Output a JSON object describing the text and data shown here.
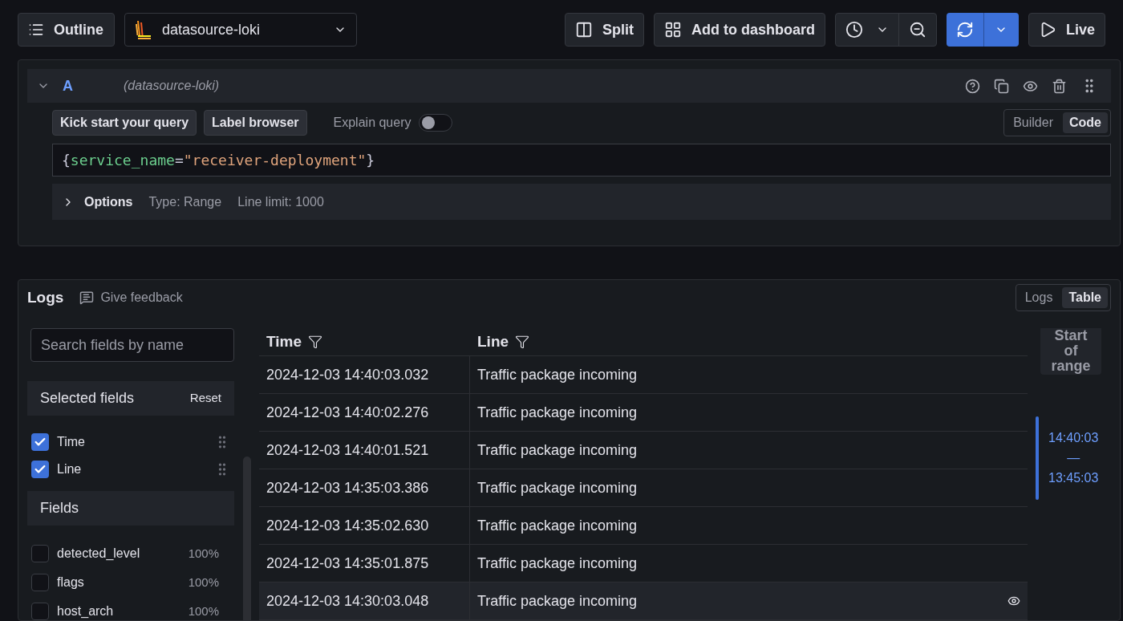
{
  "toolbar": {
    "outline": "Outline",
    "datasource": "datasource-loki",
    "split": "Split",
    "add_to_dashboard": "Add to dashboard",
    "live": "Live"
  },
  "query": {
    "ref": "A",
    "datasource": "(datasource-loki)",
    "expanded": true,
    "buttons": [
      "Kick start your query",
      "Label browser"
    ],
    "explain": {
      "label": "Explain query",
      "on": false
    },
    "mode_tabs": [
      {
        "label": "Builder",
        "selected": false
      },
      {
        "label": "Code",
        "selected": true
      }
    ],
    "expression": [
      {
        "kind": "punct",
        "text": "{"
      },
      {
        "kind": "label",
        "text": "service_name"
      },
      {
        "kind": "punct",
        "text": "="
      },
      {
        "kind": "string",
        "text": "\"receiver-deployment\""
      },
      {
        "kind": "punct",
        "text": "}"
      }
    ],
    "options": {
      "label": "Options",
      "expanded": false,
      "type": "Type: Range",
      "line_limit": "Line limit: 1000"
    }
  },
  "logs": {
    "title": "Logs",
    "feedback": "Give feedback",
    "view_tabs": [
      {
        "label": "Logs",
        "selected": false
      },
      {
        "label": "Table",
        "selected": true
      }
    ],
    "search": {
      "placeholder": "Search fields by name"
    },
    "selected_fields": {
      "title": "Selected fields",
      "reset": "Reset",
      "items": [
        {
          "name": "Time",
          "checked": true
        },
        {
          "name": "Line",
          "checked": true
        }
      ]
    },
    "fields": {
      "title": "Fields",
      "items": [
        {
          "name": "detected_level",
          "checked": false,
          "percent": "100%"
        },
        {
          "name": "flags",
          "checked": false,
          "percent": "100%"
        },
        {
          "name": "host_arch",
          "checked": false,
          "percent": "100%"
        }
      ]
    },
    "columns": [
      "Time",
      "Line"
    ],
    "rows": [
      {
        "time": "2024-12-03 14:40:03.032",
        "line": "Traffic package incoming",
        "hovered": false
      },
      {
        "time": "2024-12-03 14:40:02.276",
        "line": "Traffic package incoming",
        "hovered": false
      },
      {
        "time": "2024-12-03 14:40:01.521",
        "line": "Traffic package incoming",
        "hovered": false
      },
      {
        "time": "2024-12-03 14:35:03.386",
        "line": "Traffic package incoming",
        "hovered": false
      },
      {
        "time": "2024-12-03 14:35:02.630",
        "line": "Traffic package incoming",
        "hovered": false
      },
      {
        "time": "2024-12-03 14:35:01.875",
        "line": "Traffic package incoming",
        "hovered": false
      },
      {
        "time": "2024-12-03 14:30:03.048",
        "line": "Traffic package incoming",
        "hovered": true
      }
    ],
    "range": {
      "start_label": "Start of range",
      "from": "14:40:03",
      "separator": "—",
      "to": "13:45:03"
    }
  }
}
